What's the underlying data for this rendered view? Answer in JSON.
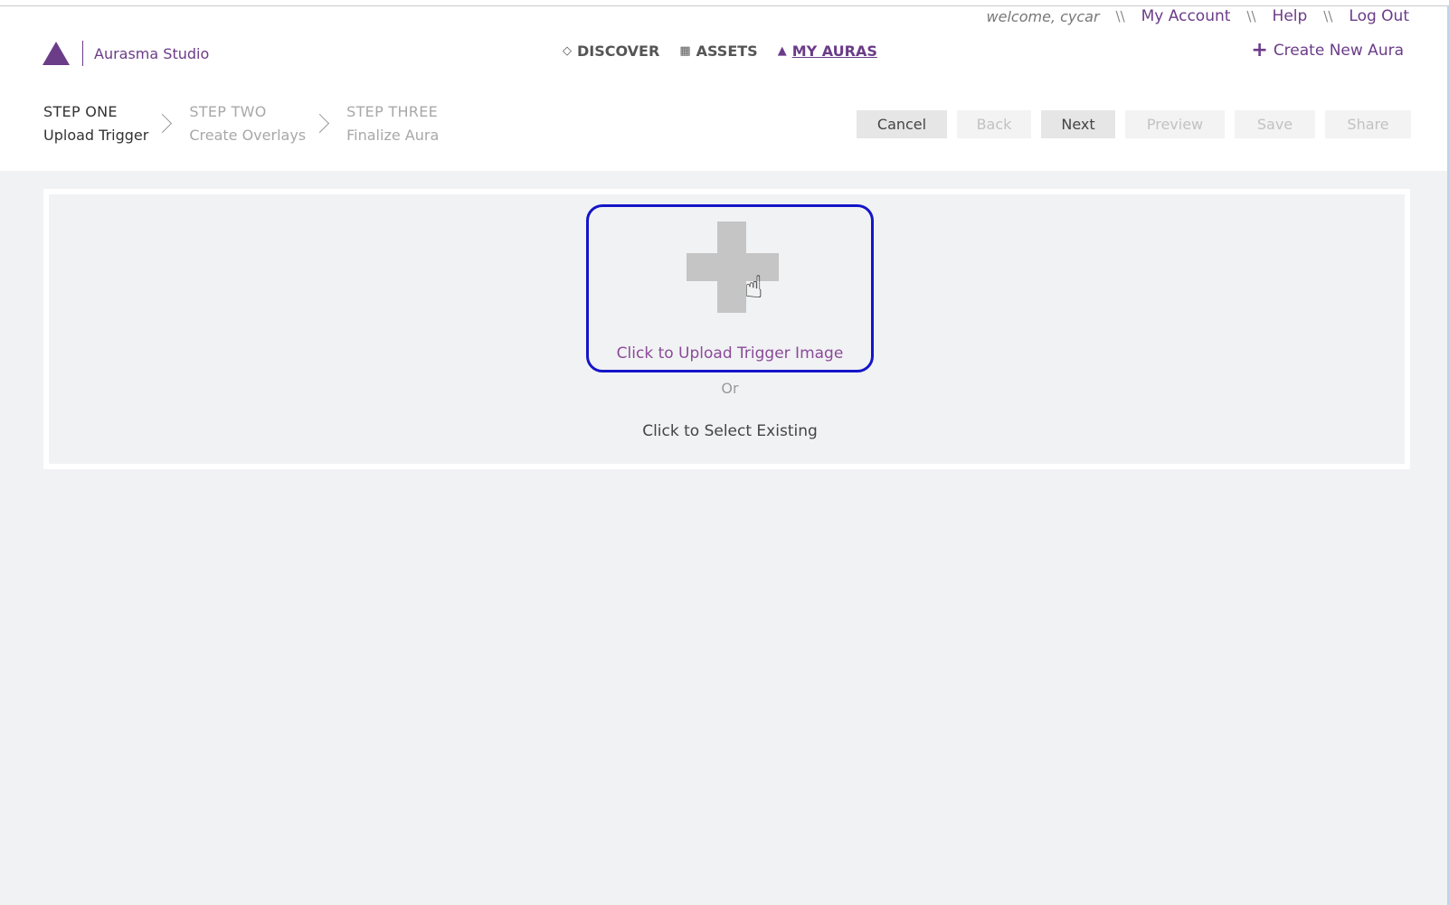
{
  "user_bar": {
    "welcome": "welcome, cycar",
    "separator": "\\\\",
    "my_account": "My Account",
    "help": "Help",
    "log_out": "Log Out"
  },
  "logo": {
    "icon": "aurasma-logo-triangle",
    "text": "Aurasma Studio"
  },
  "nav": {
    "items": [
      {
        "icon": "diamond-icon",
        "glyph": "◇",
        "label": "DISCOVER"
      },
      {
        "icon": "image-icon",
        "glyph": "▦",
        "label": "ASSETS"
      },
      {
        "icon": "aura-triangle-icon",
        "glyph": "▲",
        "label": "MY AURAS"
      }
    ],
    "active": "MY AURAS"
  },
  "create_new": {
    "icon": "plus-icon",
    "label": "Create New Aura"
  },
  "steps": [
    {
      "number": "STEP ONE",
      "title": "Upload Trigger",
      "active": true
    },
    {
      "number": "STEP TWO",
      "title": "Create Overlays",
      "active": false
    },
    {
      "number": "STEP THREE",
      "title": "Finalize Aura",
      "active": false
    }
  ],
  "actions": {
    "cancel": "Cancel",
    "back": "Back",
    "next": "Next",
    "preview": "Preview",
    "save": "Save",
    "share": "Share"
  },
  "upload": {
    "icon": "plus-icon",
    "label": "Click to Upload Trigger Image",
    "or": "Or",
    "select_existing": "Click to Select Existing"
  },
  "colors": {
    "brand": "#6b3c88",
    "highlight_border": "#1515c8",
    "background": "#f1f2f4"
  }
}
